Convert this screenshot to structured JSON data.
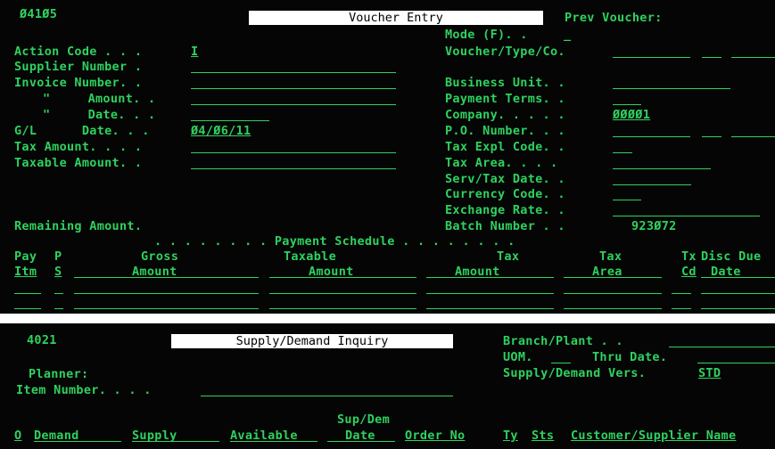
{
  "voucher": {
    "screen_id": "Ø41Ø5",
    "title": "Voucher Entry",
    "prev_voucher_label": "Prev Voucher:",
    "mode_label": "Mode (F). .",
    "mode_value": "_",
    "action_code_label": "Action Code . . .",
    "action_code_value": "I",
    "supplier_number_label": "Supplier Number .",
    "invoice_number_label": "Invoice Number. .",
    "amount_label": "\"     Amount. .",
    "date_label": "\"     Date. . .",
    "gl_date_label": "G/L      Date. . .",
    "gl_date_value": "Ø4/Ø6/11",
    "tax_amount_label": "Tax Amount. . . .",
    "taxable_amount_label": "Taxable Amount. .",
    "remaining_amount_label": "Remaining Amount.",
    "voucher_type_co_label": "Voucher/Type/Co.",
    "business_unit_label": "Business Unit. .",
    "payment_terms_label": "Payment Terms. .",
    "company_label": "Company. . . . .",
    "company_value": "ØØØØ1",
    "po_number_label": "P.O. Number. . .",
    "tax_expl_code_label": "Tax Expl Code. .",
    "tax_area_label": "Tax Area. . . .",
    "serv_tax_date_label": "Serv/Tax Date. .",
    "currency_code_label": "Currency Code. .",
    "exchange_rate_label": "Exchange Rate. .",
    "batch_number_label": "Batch Number . .",
    "batch_number_value": "923Ø72",
    "payment_schedule_label": ". . . . . . . . Payment Schedule . . . . . . . .",
    "columns": {
      "pay_itm_top": "Pay",
      "pay_itm_bottom": "Itm",
      "ps_top": "P",
      "ps_bottom": "S",
      "gross_top": "Gross",
      "gross_bottom": "Amount",
      "taxable_top": "Taxable",
      "taxable_bottom": "Amount",
      "tax_top": "Tax",
      "tax_bottom": "Amount",
      "taxarea_top": "Tax",
      "taxarea_bottom": "Area",
      "txcd_top": "Tx",
      "txcd_bottom": "Cd",
      "disc_due_top": "Disc Due",
      "disc_due_bottom": "Date"
    }
  },
  "supply": {
    "screen_id": "4021",
    "title": "Supply/Demand Inquiry",
    "branch_plant_label": "Branch/Plant . .",
    "uom_label": "UOM.",
    "thru_date_label": "Thru Date.",
    "planner_label": "Planner:",
    "sd_vers_label": "Supply/Demand Vers.",
    "sd_vers_value": "STD",
    "item_number_label": "Item Number. . . .",
    "columns": {
      "o": "O",
      "demand": "Demand",
      "supply": "Supply",
      "available": "Available",
      "supdem_top": "Sup/Dem",
      "date": "Date",
      "order_no": "Order No",
      "ty": "Ty",
      "sts": "Sts",
      "customer": "Customer/Supplier Name"
    }
  },
  "colors": {
    "screen": "#050505",
    "text": "#2fd15f",
    "title_bg": "#ffffff"
  }
}
